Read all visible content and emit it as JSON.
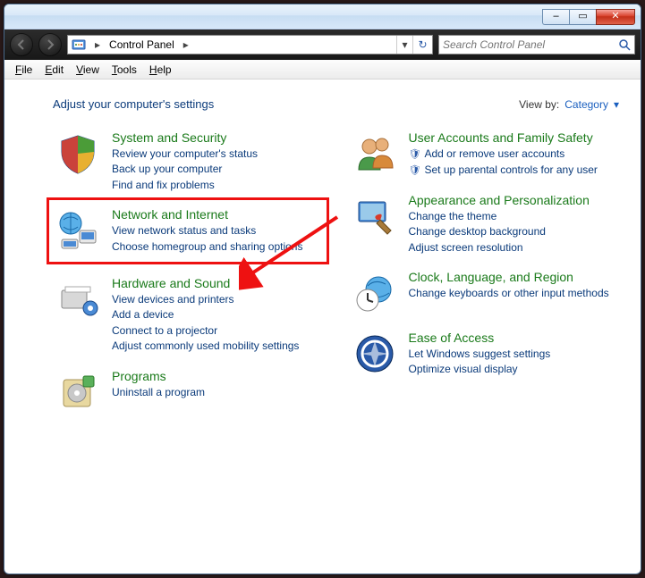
{
  "titlebar": {
    "minimize": "–",
    "maximize": "▭",
    "close": "✕"
  },
  "address": {
    "location_label": "Control Panel",
    "chevron": "▸",
    "dropdown": "▾",
    "refresh": "↻"
  },
  "search": {
    "placeholder": "Search Control Panel"
  },
  "menu": {
    "file": "File",
    "edit": "Edit",
    "view": "View",
    "tools": "Tools",
    "help": "Help"
  },
  "heading": "Adjust your computer's settings",
  "viewby": {
    "label": "View by:",
    "value": "Category",
    "caret": "▾"
  },
  "left": {
    "system": {
      "title": "System and Security",
      "links": [
        "Review your computer's status",
        "Back up your computer",
        "Find and fix problems"
      ]
    },
    "network": {
      "title": "Network and Internet",
      "links": [
        "View network status and tasks",
        "Choose homegroup and sharing options"
      ]
    },
    "hardware": {
      "title": "Hardware and Sound",
      "links": [
        "View devices and printers",
        "Add a device",
        "Connect to a projector",
        "Adjust commonly used mobility settings"
      ]
    },
    "programs": {
      "title": "Programs",
      "links": [
        "Uninstall a program"
      ]
    }
  },
  "right": {
    "users": {
      "title": "User Accounts and Family Safety",
      "links": [
        "Add or remove user accounts",
        "Set up parental controls for any user"
      ]
    },
    "appearance": {
      "title": "Appearance and Personalization",
      "links": [
        "Change the theme",
        "Change desktop background",
        "Adjust screen resolution"
      ]
    },
    "clock": {
      "title": "Clock, Language, and Region",
      "links": [
        "Change keyboards or other input methods"
      ]
    },
    "ease": {
      "title": "Ease of Access",
      "links": [
        "Let Windows suggest settings",
        "Optimize visual display"
      ]
    }
  }
}
